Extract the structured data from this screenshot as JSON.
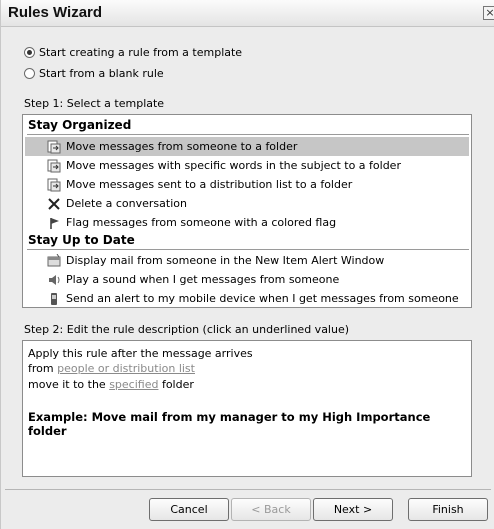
{
  "window": {
    "title": "Rules Wizard",
    "close_glyph": "×"
  },
  "options": [
    {
      "label": "Start creating a rule from a template",
      "checked": true
    },
    {
      "label": "Start from a blank rule",
      "checked": false
    }
  ],
  "step1": {
    "label": "Step 1: Select a template",
    "groups": [
      {
        "name": "Stay Organized",
        "items": [
          {
            "label": "Move messages from someone to a folder",
            "icon": "move-to-folder-icon",
            "selected": true
          },
          {
            "label": "Move messages with specific words in the subject to a folder",
            "icon": "move-to-folder-icon"
          },
          {
            "label": "Move messages sent to a distribution list to a folder",
            "icon": "move-to-folder-icon"
          },
          {
            "label": "Delete a conversation",
            "icon": "delete-x-icon"
          },
          {
            "label": "Flag messages from someone with a colored flag",
            "icon": "flag-icon"
          }
        ]
      },
      {
        "name": "Stay Up to Date",
        "items": [
          {
            "label": "Display mail from someone in the New Item Alert Window",
            "icon": "alert-window-icon"
          },
          {
            "label": "Play a sound when I get messages from someone",
            "icon": "speaker-icon"
          },
          {
            "label": "Send an alert to my mobile device when I get messages from someone",
            "icon": "mobile-device-icon"
          }
        ]
      }
    ]
  },
  "step2": {
    "label": "Step 2: Edit the rule description (click an underlined value)",
    "line1": "Apply this rule after the message arrives",
    "line2_prefix": "from ",
    "line2_link": "people or distribution list",
    "line3_prefix": "move it to the ",
    "line3_link": "specified",
    "line3_suffix": " folder",
    "example": "Example: Move mail from my manager to my High Importance folder"
  },
  "buttons": {
    "cancel": "Cancel",
    "back": "< Back",
    "next": "Next >",
    "finish": "Finish"
  }
}
